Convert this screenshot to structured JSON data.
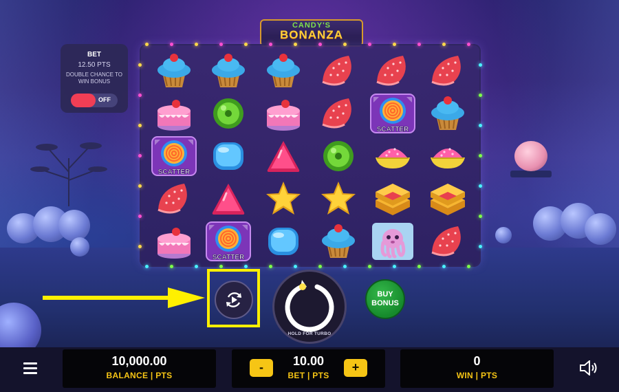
{
  "logo": {
    "line1": "CANDY'S",
    "line2": "BONANZA"
  },
  "bet_panel": {
    "title": "BET",
    "amount": "12.50 PTS",
    "description": "DOUBLE CHANCE TO WIN BONUS",
    "toggle_state": "OFF"
  },
  "reels": {
    "scatter_label": "SCATTER",
    "grid": [
      [
        "cupcake",
        "cupcake",
        "cupcake",
        "jelly-slice",
        "jelly-slice",
        "jelly-slice"
      ],
      [
        "cake",
        "green-candy",
        "cake",
        "jelly-slice",
        "scatter-lollipop",
        "cupcake"
      ],
      [
        "scatter-lollipop",
        "blue-candy",
        "pink-triangle",
        "green-candy",
        "pink-bowl",
        "pink-bowl"
      ],
      [
        "jelly-slice",
        "pink-triangle",
        "star",
        "star",
        "waffle",
        "waffle"
      ],
      [
        "cake",
        "scatter-lollipop",
        "blue-candy",
        "cupcake",
        "octopus",
        "jelly-slice"
      ]
    ]
  },
  "controls": {
    "spin_hint": "HOLD FOR TURBO",
    "buy_bonus_line1": "BUY",
    "buy_bonus_line2": "BONUS"
  },
  "bottom_bar": {
    "balance_value": "10,000.00",
    "balance_label": "BALANCE | PTS",
    "bet_value": "10.00",
    "bet_label": "BET | PTS",
    "minus_label": "-",
    "plus_label": "+",
    "win_value": "0",
    "win_label": "WIN | PTS"
  },
  "colors": {
    "accent_yellow": "#f6c515",
    "highlight": "#fff000",
    "toggle_red": "#f03e55",
    "buy_bonus_green": "#1f9d37"
  },
  "icons": [
    "menu-icon",
    "sound-icon",
    "autoplay-icon",
    "spin-icon",
    "arrow-icon"
  ]
}
